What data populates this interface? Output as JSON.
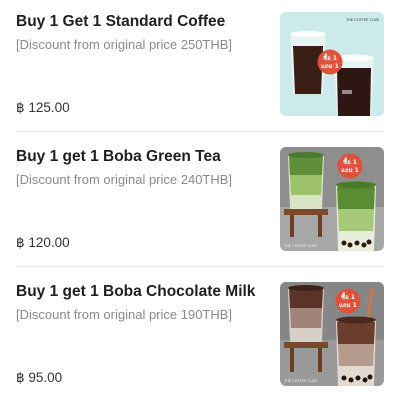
{
  "items": [
    {
      "title": "Buy 1 Get 1 Standard Coffee",
      "subtitle": "[Discount from original price 250THB]",
      "price": "฿ 125.00",
      "image": {
        "kind": "iced-coffee-promo",
        "background": "#cdeaea",
        "badge_line1": "ซื้อ 1",
        "badge_line2": "แถม 1"
      }
    },
    {
      "title": "Buy 1 get 1 Boba Green Tea",
      "subtitle": "[Discount from original price 240THB]",
      "price": "฿ 120.00",
      "image": {
        "kind": "green-tea-boba-promo",
        "background": "#9a9a9a",
        "badge_line1": "ซื้อ 1",
        "badge_line2": "แถม 1"
      }
    },
    {
      "title": "Buy 1 get 1 Boba Chocolate Milk",
      "subtitle": "[Discount from original price 190THB]",
      "price": "฿ 95.00",
      "image": {
        "kind": "chocolate-boba-promo",
        "background": "#8f8f8f",
        "badge_line1": "ซื้อ 1",
        "badge_line2": "แถม 1"
      }
    }
  ]
}
